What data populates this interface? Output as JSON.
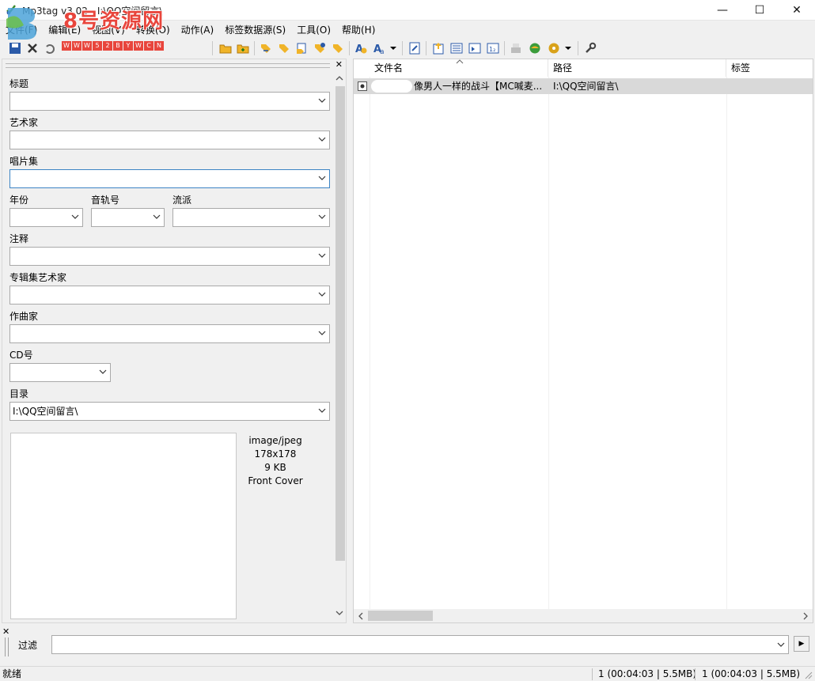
{
  "window": {
    "title": "Mp3tag v3.02  -  I:\\QQ空间留言\\",
    "minimize": "—",
    "maximize": "☐",
    "close": "✕"
  },
  "watermark": {
    "text": "8号资源网",
    "url_chars": [
      "W",
      "W",
      "W",
      "5",
      "2",
      "B",
      "Y",
      "W",
      "C",
      "N"
    ]
  },
  "menu": [
    "文件(F)",
    "编辑(E)",
    "视图(V)",
    "转换(O)",
    "动作(A)",
    "标签数据源(S)",
    "工具(O)",
    "帮助(H)"
  ],
  "toolbar_icons": [
    "save-icon",
    "delete-icon",
    "undo-icon",
    "folder-open-icon",
    "folder-add-icon",
    "tag-to-filename-icon",
    "filename-to-tag-icon",
    "text-file-icon",
    "tag-to-tag-icon",
    "case-convert-icon",
    "font-icon",
    "edit-tag-icon",
    "export-icon",
    "playlist-icon",
    "auto-numbering-icon",
    "freedb-icon",
    "web-source-icon",
    "discogs-icon",
    "settings-wrench-icon"
  ],
  "tag_panel": {
    "close": "✕",
    "fields": {
      "title_label": "标题",
      "title_value": "",
      "artist_label": "艺术家",
      "artist_value": "",
      "album_label": "唱片集",
      "album_value": "",
      "year_label": "年份",
      "year_value": "",
      "track_label": "音轨号",
      "track_value": "",
      "genre_label": "流派",
      "genre_value": "",
      "comment_label": "注释",
      "comment_value": "",
      "album_artist_label": "专辑集艺术家",
      "album_artist_value": "",
      "composer_label": "作曲家",
      "composer_value": "",
      "disc_label": "CD号",
      "disc_value": "",
      "directory_label": "目录",
      "directory_value": "I:\\QQ空间留言\\"
    },
    "cover": {
      "mime": "image/jpeg",
      "dimensions": "178x178",
      "size": "9 KB",
      "type": "Front Cover"
    }
  },
  "file_list": {
    "columns": [
      "文件名",
      "路径",
      "标签"
    ],
    "rows": [
      {
        "filename": "像男人一样的战斗【MC喊麦...",
        "path": "I:\\QQ空间留言\\",
        "tag": ""
      }
    ]
  },
  "filter": {
    "close": "✕",
    "label": "过滤",
    "value": "",
    "go": "▶"
  },
  "status": {
    "left": "就绪",
    "selected": "1 (00:04:03 | 5.5MB)",
    "total": "1 (00:04:03 | 5.5MB)"
  }
}
